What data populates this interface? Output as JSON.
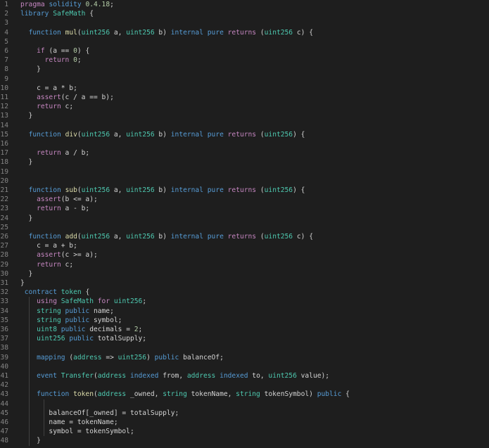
{
  "editor": {
    "language": "solidity",
    "colors": {
      "background": "#1e1e1e",
      "line_number": "#858585",
      "keyword": "#c586c0",
      "storage": "#569cd6",
      "type": "#4ec9b0",
      "function": "#dcdcaa",
      "number": "#b5cea8",
      "plain": "#d4d4d4"
    },
    "lines": [
      {
        "n": "1",
        "guides": [],
        "tokens": [
          [
            "kw",
            "pragma"
          ],
          [
            "pl",
            " "
          ],
          [
            "st",
            "solidity"
          ],
          [
            "pl",
            " "
          ],
          [
            "nm",
            "0.4.18"
          ],
          [
            "pl",
            ";"
          ]
        ]
      },
      {
        "n": "2",
        "guides": [],
        "tokens": [
          [
            "st",
            "library"
          ],
          [
            "pl",
            " "
          ],
          [
            "ty",
            "SafeMath"
          ],
          [
            "pl",
            " {"
          ]
        ]
      },
      {
        "n": "3",
        "guides": [],
        "tokens": []
      },
      {
        "n": "4",
        "guides": [],
        "tokens": [
          [
            "pl",
            "  "
          ],
          [
            "st",
            "function"
          ],
          [
            "pl",
            " "
          ],
          [
            "fn",
            "mul"
          ],
          [
            "pl",
            "("
          ],
          [
            "ty",
            "uint256"
          ],
          [
            "pl",
            " a, "
          ],
          [
            "ty",
            "uint256"
          ],
          [
            "pl",
            " b) "
          ],
          [
            "st",
            "internal"
          ],
          [
            "pl",
            " "
          ],
          [
            "st",
            "pure"
          ],
          [
            "pl",
            " "
          ],
          [
            "kw",
            "returns"
          ],
          [
            "pl",
            " ("
          ],
          [
            "ty",
            "uint256"
          ],
          [
            "pl",
            " c) {"
          ]
        ]
      },
      {
        "n": "5",
        "guides": [],
        "tokens": []
      },
      {
        "n": "6",
        "guides": [],
        "tokens": [
          [
            "pl",
            "    "
          ],
          [
            "kw",
            "if"
          ],
          [
            "pl",
            " (a == "
          ],
          [
            "nm",
            "0"
          ],
          [
            "pl",
            ") {"
          ]
        ]
      },
      {
        "n": "7",
        "guides": [],
        "tokens": [
          [
            "pl",
            "      "
          ],
          [
            "kw",
            "return"
          ],
          [
            "pl",
            " "
          ],
          [
            "nm",
            "0"
          ],
          [
            "pl",
            ";"
          ]
        ]
      },
      {
        "n": "8",
        "guides": [],
        "tokens": [
          [
            "pl",
            "    }"
          ]
        ]
      },
      {
        "n": "9",
        "guides": [],
        "tokens": []
      },
      {
        "n": "10",
        "guides": [],
        "tokens": [
          [
            "pl",
            "    c = a * b;"
          ]
        ]
      },
      {
        "n": "11",
        "guides": [],
        "tokens": [
          [
            "pl",
            "    "
          ],
          [
            "kw",
            "assert"
          ],
          [
            "pl",
            "(c / a == b);"
          ]
        ]
      },
      {
        "n": "12",
        "guides": [],
        "tokens": [
          [
            "pl",
            "    "
          ],
          [
            "kw",
            "return"
          ],
          [
            "pl",
            " c;"
          ]
        ]
      },
      {
        "n": "13",
        "guides": [],
        "tokens": [
          [
            "pl",
            "  }"
          ]
        ]
      },
      {
        "n": "14",
        "guides": [],
        "tokens": []
      },
      {
        "n": "15",
        "guides": [],
        "tokens": [
          [
            "pl",
            "  "
          ],
          [
            "st",
            "function"
          ],
          [
            "pl",
            " "
          ],
          [
            "fn",
            "div"
          ],
          [
            "pl",
            "("
          ],
          [
            "ty",
            "uint256"
          ],
          [
            "pl",
            " a, "
          ],
          [
            "ty",
            "uint256"
          ],
          [
            "pl",
            " b) "
          ],
          [
            "st",
            "internal"
          ],
          [
            "pl",
            " "
          ],
          [
            "st",
            "pure"
          ],
          [
            "pl",
            " "
          ],
          [
            "kw",
            "returns"
          ],
          [
            "pl",
            " ("
          ],
          [
            "ty",
            "uint256"
          ],
          [
            "pl",
            ") {"
          ]
        ]
      },
      {
        "n": "16",
        "guides": [],
        "tokens": []
      },
      {
        "n": "17",
        "guides": [],
        "tokens": [
          [
            "pl",
            "    "
          ],
          [
            "kw",
            "return"
          ],
          [
            "pl",
            " a / b;"
          ]
        ]
      },
      {
        "n": "18",
        "guides": [],
        "tokens": [
          [
            "pl",
            "  }"
          ]
        ]
      },
      {
        "n": "19",
        "guides": [],
        "tokens": []
      },
      {
        "n": "20",
        "guides": [],
        "tokens": []
      },
      {
        "n": "21",
        "guides": [],
        "tokens": [
          [
            "pl",
            "  "
          ],
          [
            "st",
            "function"
          ],
          [
            "pl",
            " "
          ],
          [
            "fn",
            "sub"
          ],
          [
            "pl",
            "("
          ],
          [
            "ty",
            "uint256"
          ],
          [
            "pl",
            " a, "
          ],
          [
            "ty",
            "uint256"
          ],
          [
            "pl",
            " b) "
          ],
          [
            "st",
            "internal"
          ],
          [
            "pl",
            " "
          ],
          [
            "st",
            "pure"
          ],
          [
            "pl",
            " "
          ],
          [
            "kw",
            "returns"
          ],
          [
            "pl",
            " ("
          ],
          [
            "ty",
            "uint256"
          ],
          [
            "pl",
            ") {"
          ]
        ]
      },
      {
        "n": "22",
        "guides": [],
        "tokens": [
          [
            "pl",
            "    "
          ],
          [
            "kw",
            "assert"
          ],
          [
            "pl",
            "(b <= a);"
          ]
        ]
      },
      {
        "n": "23",
        "guides": [],
        "tokens": [
          [
            "pl",
            "    "
          ],
          [
            "kw",
            "return"
          ],
          [
            "pl",
            " a - b;"
          ]
        ]
      },
      {
        "n": "24",
        "guides": [],
        "tokens": [
          [
            "pl",
            "  }"
          ]
        ]
      },
      {
        "n": "25",
        "guides": [],
        "tokens": []
      },
      {
        "n": "26",
        "guides": [],
        "tokens": [
          [
            "pl",
            "  "
          ],
          [
            "st",
            "function"
          ],
          [
            "pl",
            " "
          ],
          [
            "fn",
            "add"
          ],
          [
            "pl",
            "("
          ],
          [
            "ty",
            "uint256"
          ],
          [
            "pl",
            " a, "
          ],
          [
            "ty",
            "uint256"
          ],
          [
            "pl",
            " b) "
          ],
          [
            "st",
            "internal"
          ],
          [
            "pl",
            " "
          ],
          [
            "st",
            "pure"
          ],
          [
            "pl",
            " "
          ],
          [
            "kw",
            "returns"
          ],
          [
            "pl",
            " ("
          ],
          [
            "ty",
            "uint256"
          ],
          [
            "pl",
            " c) {"
          ]
        ]
      },
      {
        "n": "27",
        "guides": [],
        "tokens": [
          [
            "pl",
            "    c = a + b;"
          ]
        ]
      },
      {
        "n": "28",
        "guides": [],
        "tokens": [
          [
            "pl",
            "    "
          ],
          [
            "kw",
            "assert"
          ],
          [
            "pl",
            "(c >= a);"
          ]
        ]
      },
      {
        "n": "29",
        "guides": [],
        "tokens": [
          [
            "pl",
            "    "
          ],
          [
            "kw",
            "return"
          ],
          [
            "pl",
            " c;"
          ]
        ]
      },
      {
        "n": "30",
        "guides": [],
        "tokens": [
          [
            "pl",
            "  }"
          ]
        ]
      },
      {
        "n": "31",
        "guides": [],
        "tokens": [
          [
            "pl",
            "}"
          ]
        ]
      },
      {
        "n": "32",
        "guides": [],
        "tokens": [
          [
            "pl",
            " "
          ],
          [
            "st",
            "contract"
          ],
          [
            "pl",
            " "
          ],
          [
            "ty",
            "token"
          ],
          [
            "pl",
            " {"
          ]
        ]
      },
      {
        "n": "33",
        "guides": [
          1
        ],
        "tokens": [
          [
            "pl",
            "    "
          ],
          [
            "kw",
            "using"
          ],
          [
            "pl",
            " "
          ],
          [
            "ty",
            "SafeMath"
          ],
          [
            "pl",
            " "
          ],
          [
            "kw",
            "for"
          ],
          [
            "pl",
            " "
          ],
          [
            "ty",
            "uint256"
          ],
          [
            "pl",
            ";"
          ]
        ]
      },
      {
        "n": "34",
        "guides": [
          1
        ],
        "tokens": [
          [
            "pl",
            "    "
          ],
          [
            "ty",
            "string"
          ],
          [
            "pl",
            " "
          ],
          [
            "st",
            "public"
          ],
          [
            "pl",
            " name;"
          ]
        ]
      },
      {
        "n": "35",
        "guides": [
          1
        ],
        "tokens": [
          [
            "pl",
            "    "
          ],
          [
            "ty",
            "string"
          ],
          [
            "pl",
            " "
          ],
          [
            "st",
            "public"
          ],
          [
            "pl",
            " symbol;"
          ]
        ]
      },
      {
        "n": "36",
        "guides": [
          1
        ],
        "tokens": [
          [
            "pl",
            "    "
          ],
          [
            "ty",
            "uint8"
          ],
          [
            "pl",
            " "
          ],
          [
            "st",
            "public"
          ],
          [
            "pl",
            " decimals = "
          ],
          [
            "nm",
            "2"
          ],
          [
            "pl",
            ";"
          ]
        ]
      },
      {
        "n": "37",
        "guides": [
          1
        ],
        "tokens": [
          [
            "pl",
            "    "
          ],
          [
            "ty",
            "uint256"
          ],
          [
            "pl",
            " "
          ],
          [
            "st",
            "public"
          ],
          [
            "pl",
            " totalSupply;"
          ]
        ]
      },
      {
        "n": "38",
        "guides": [
          1
        ],
        "tokens": []
      },
      {
        "n": "39",
        "guides": [
          1
        ],
        "tokens": [
          [
            "pl",
            "    "
          ],
          [
            "st",
            "mapping"
          ],
          [
            "pl",
            " ("
          ],
          [
            "ty",
            "address"
          ],
          [
            "pl",
            " => "
          ],
          [
            "ty",
            "uint256"
          ],
          [
            "pl",
            ") "
          ],
          [
            "st",
            "public"
          ],
          [
            "pl",
            " balanceOf;"
          ]
        ]
      },
      {
        "n": "40",
        "guides": [
          1
        ],
        "tokens": []
      },
      {
        "n": "41",
        "guides": [
          1
        ],
        "tokens": [
          [
            "pl",
            "    "
          ],
          [
            "st",
            "event"
          ],
          [
            "pl",
            " "
          ],
          [
            "ty",
            "Transfer"
          ],
          [
            "pl",
            "("
          ],
          [
            "ty",
            "address"
          ],
          [
            "pl",
            " "
          ],
          [
            "st",
            "indexed"
          ],
          [
            "pl",
            " from, "
          ],
          [
            "ty",
            "address"
          ],
          [
            "pl",
            " "
          ],
          [
            "st",
            "indexed"
          ],
          [
            "pl",
            " to, "
          ],
          [
            "ty",
            "uint256"
          ],
          [
            "pl",
            " value);"
          ]
        ]
      },
      {
        "n": "42",
        "guides": [
          1
        ],
        "tokens": []
      },
      {
        "n": "43",
        "guides": [
          1
        ],
        "tokens": [
          [
            "pl",
            "    "
          ],
          [
            "st",
            "function"
          ],
          [
            "pl",
            " "
          ],
          [
            "fn",
            "token"
          ],
          [
            "pl",
            "("
          ],
          [
            "ty",
            "address"
          ],
          [
            "pl",
            " _owned, "
          ],
          [
            "ty",
            "string"
          ],
          [
            "pl",
            " tokenName, "
          ],
          [
            "ty",
            "string"
          ],
          [
            "pl",
            " tokenSymbol) "
          ],
          [
            "st",
            "public"
          ],
          [
            "pl",
            " {"
          ]
        ]
      },
      {
        "n": "44",
        "guides": [
          1,
          2
        ],
        "tokens": []
      },
      {
        "n": "45",
        "guides": [
          1,
          2
        ],
        "tokens": [
          [
            "pl",
            "       balanceOf[_owned] = totalSupply;"
          ]
        ]
      },
      {
        "n": "46",
        "guides": [
          1,
          2
        ],
        "tokens": [
          [
            "pl",
            "       name = tokenName;"
          ]
        ]
      },
      {
        "n": "47",
        "guides": [
          1,
          2
        ],
        "tokens": [
          [
            "pl",
            "       symbol = tokenSymbol;"
          ]
        ]
      },
      {
        "n": "48",
        "guides": [
          1
        ],
        "tokens": [
          [
            "pl",
            "    }"
          ]
        ]
      }
    ]
  }
}
